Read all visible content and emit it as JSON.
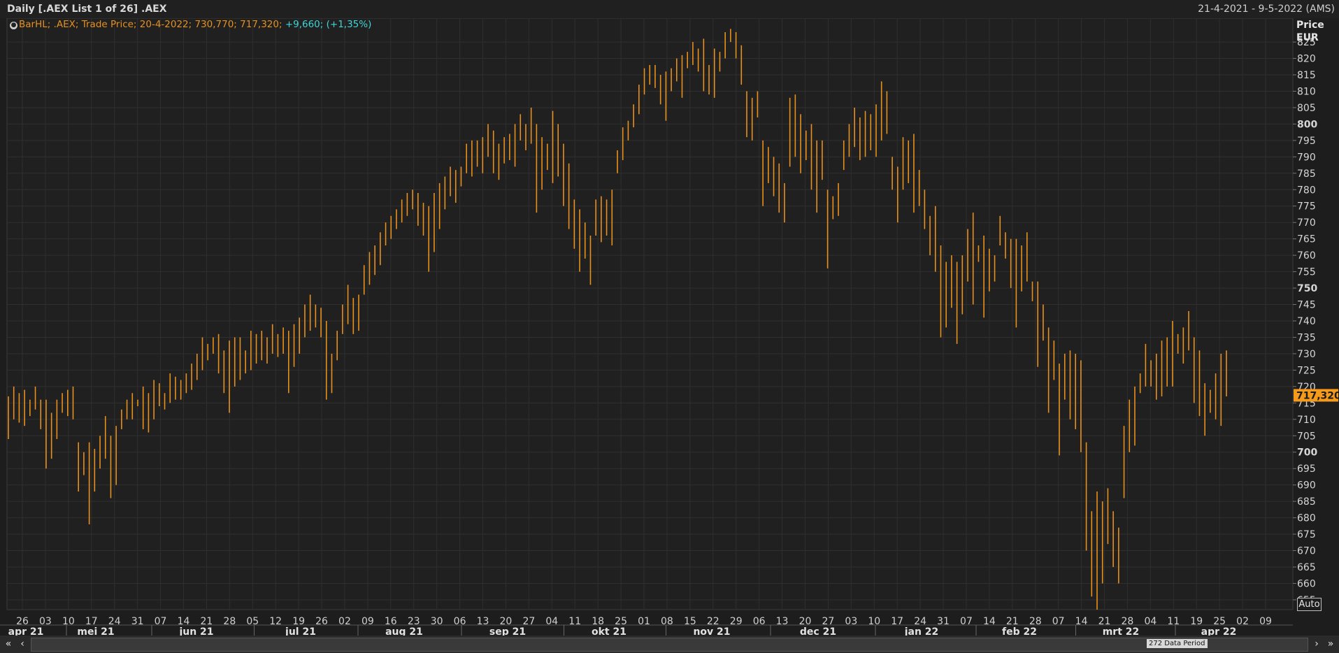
{
  "window": {
    "title": "Daily [.AEX List 1 of 26] .AEX",
    "date_range": "21-4-2021 - 9-5-2022 (AMS)"
  },
  "legend": {
    "text": "BarHL; .AEX; Trade Price; 20-4-2022; 730,770; 717,320;",
    "change": "+9,660; (+1,35%)"
  },
  "axis": {
    "title_line1": "Price",
    "title_line2": "EUR",
    "last_price_label": "717,320",
    "auto_label": "Auto"
  },
  "scrollbar": {
    "period_label": "272 Data Period",
    "left_fast": "«",
    "left": "‹",
    "right": "›",
    "right_fast": "»"
  },
  "colors": {
    "bar": "#e8901c",
    "price_tag": "#f59a1b",
    "change": "#3ed6d8",
    "background": "#1d1d1d",
    "grid": "#2f2f2f"
  },
  "chart_data": {
    "type": "bar",
    "style": "high-low bars",
    "ylim": [
      652,
      828
    ],
    "y_ticks": [
      655,
      660,
      665,
      670,
      675,
      680,
      685,
      690,
      695,
      700,
      705,
      710,
      715,
      720,
      725,
      730,
      735,
      740,
      745,
      750,
      755,
      760,
      765,
      770,
      775,
      780,
      785,
      790,
      795,
      800,
      805,
      810,
      815,
      820,
      825
    ],
    "y_bold_ticks": [
      700,
      750,
      800
    ],
    "last_value": 717.32,
    "x_tick_labels": [
      "26",
      "03",
      "10",
      "17",
      "24",
      "31",
      "07",
      "14",
      "21",
      "28",
      "05",
      "12",
      "19",
      "26",
      "02",
      "09",
      "16",
      "23",
      "30",
      "06",
      "13",
      "20",
      "27",
      "04",
      "11",
      "18",
      "25",
      "01",
      "08",
      "15",
      "22",
      "29",
      "06",
      "13",
      "20",
      "27",
      "03",
      "10",
      "17",
      "24",
      "31",
      "07",
      "14",
      "21",
      "28",
      "07",
      "14",
      "21",
      "28",
      "04",
      "11",
      "19",
      "25",
      "02",
      "09"
    ],
    "month_labels": [
      "apr 21",
      "mei 21",
      "jun 21",
      "jul 21",
      "aug 21",
      "sep 21",
      "okt 21",
      "nov 21",
      "dec 21",
      "jan 22",
      "feb 22",
      "mrt 22",
      "apr 22"
    ],
    "bars": [
      [
        704,
        717
      ],
      [
        710,
        720
      ],
      [
        709,
        718
      ],
      [
        708,
        719
      ],
      [
        711,
        716
      ],
      [
        713,
        720
      ],
      [
        707,
        716
      ],
      [
        695,
        716
      ],
      [
        698,
        712
      ],
      [
        704,
        716
      ],
      [
        712,
        718
      ],
      [
        711,
        719
      ],
      [
        710,
        720
      ],
      [
        688,
        703
      ],
      [
        693,
        700
      ],
      [
        678,
        703
      ],
      [
        688,
        701
      ],
      [
        695,
        705
      ],
      [
        698,
        711
      ],
      [
        686,
        705
      ],
      [
        690,
        708
      ],
      [
        707,
        713
      ],
      [
        710,
        716
      ],
      [
        710,
        718
      ],
      [
        714,
        716
      ],
      [
        707,
        720
      ],
      [
        706,
        718
      ],
      [
        710,
        722
      ],
      [
        714,
        721
      ],
      [
        713,
        718
      ],
      [
        715,
        724
      ],
      [
        716,
        723
      ],
      [
        716,
        722
      ],
      [
        718,
        724
      ],
      [
        719,
        727
      ],
      [
        722,
        730
      ],
      [
        725,
        735
      ],
      [
        728,
        733
      ],
      [
        730,
        735
      ],
      [
        724,
        736
      ],
      [
        718,
        731
      ],
      [
        712,
        734
      ],
      [
        720,
        735
      ],
      [
        722,
        735
      ],
      [
        724,
        731
      ],
      [
        725,
        737
      ],
      [
        727,
        736
      ],
      [
        728,
        737
      ],
      [
        727,
        735
      ],
      [
        730,
        739
      ],
      [
        729,
        736
      ],
      [
        730,
        738
      ],
      [
        718,
        737
      ],
      [
        726,
        739
      ],
      [
        730,
        741
      ],
      [
        735,
        745
      ],
      [
        737,
        748
      ],
      [
        738,
        745
      ],
      [
        735,
        744
      ],
      [
        716,
        740
      ],
      [
        718,
        730
      ],
      [
        728,
        737
      ],
      [
        736,
        745
      ],
      [
        739,
        751
      ],
      [
        736,
        747
      ],
      [
        737,
        748
      ],
      [
        748,
        757
      ],
      [
        751,
        761
      ],
      [
        754,
        763
      ],
      [
        757,
        767
      ],
      [
        763,
        770
      ],
      [
        765,
        772
      ],
      [
        768,
        774
      ],
      [
        770,
        777
      ],
      [
        772,
        779
      ],
      [
        774,
        780
      ],
      [
        769,
        779
      ],
      [
        766,
        776
      ],
      [
        755,
        775
      ],
      [
        761,
        779
      ],
      [
        768,
        782
      ],
      [
        774,
        784
      ],
      [
        778,
        787
      ],
      [
        776,
        786
      ],
      [
        781,
        787
      ],
      [
        785,
        794
      ],
      [
        784,
        795
      ],
      [
        787,
        795
      ],
      [
        785,
        796
      ],
      [
        790,
        800
      ],
      [
        785,
        798
      ],
      [
        783,
        794
      ],
      [
        788,
        796
      ],
      [
        789,
        797
      ],
      [
        787,
        800
      ],
      [
        795,
        803
      ],
      [
        792,
        800
      ],
      [
        794,
        805
      ],
      [
        773,
        800
      ],
      [
        780,
        796
      ],
      [
        786,
        794
      ],
      [
        782,
        804
      ],
      [
        784,
        800
      ],
      [
        775,
        794
      ],
      [
        768,
        788
      ],
      [
        762,
        777
      ],
      [
        755,
        774
      ],
      [
        759,
        770
      ],
      [
        751,
        766
      ],
      [
        766,
        777
      ],
      [
        764,
        778
      ],
      [
        766,
        777
      ],
      [
        763,
        780
      ],
      [
        785,
        792
      ],
      [
        789,
        799
      ],
      [
        795,
        801
      ],
      [
        799,
        806
      ],
      [
        803,
        812
      ],
      [
        809,
        817
      ],
      [
        812,
        818
      ],
      [
        811,
        818
      ],
      [
        806,
        815
      ],
      [
        801,
        816
      ],
      [
        810,
        817
      ],
      [
        813,
        820
      ],
      [
        808,
        821
      ],
      [
        817,
        822
      ],
      [
        818,
        825
      ],
      [
        816,
        823
      ],
      [
        810,
        826
      ],
      [
        809,
        818
      ],
      [
        808,
        823
      ],
      [
        816,
        822
      ],
      [
        820,
        828
      ],
      [
        825,
        829
      ],
      [
        820,
        828
      ],
      [
        812,
        824
      ],
      [
        796,
        810
      ],
      [
        795,
        808
      ],
      [
        802,
        810
      ],
      [
        775,
        795
      ],
      [
        782,
        793
      ],
      [
        778,
        790
      ],
      [
        773,
        788
      ],
      [
        770,
        782
      ],
      [
        787,
        808
      ],
      [
        790,
        809
      ],
      [
        785,
        803
      ],
      [
        789,
        798
      ],
      [
        780,
        800
      ],
      [
        773,
        795
      ],
      [
        783,
        795
      ],
      [
        756,
        780
      ],
      [
        771,
        778
      ],
      [
        772,
        782
      ],
      [
        786,
        795
      ],
      [
        790,
        800
      ],
      [
        793,
        805
      ],
      [
        789,
        802
      ],
      [
        790,
        804
      ],
      [
        792,
        803
      ],
      [
        790,
        806
      ],
      [
        795,
        813
      ],
      [
        797,
        810
      ],
      [
        780,
        790
      ],
      [
        770,
        787
      ],
      [
        780,
        796
      ],
      [
        782,
        795
      ],
      [
        773,
        797
      ],
      [
        775,
        786
      ],
      [
        768,
        780
      ],
      [
        760,
        772
      ],
      [
        755,
        775
      ],
      [
        735,
        763
      ],
      [
        738,
        758
      ],
      [
        744,
        760
      ],
      [
        733,
        758
      ],
      [
        742,
        760
      ],
      [
        752,
        768
      ],
      [
        745,
        773
      ],
      [
        758,
        763
      ],
      [
        741,
        766
      ],
      [
        749,
        762
      ],
      [
        752,
        760
      ],
      [
        763,
        772
      ],
      [
        759,
        767
      ],
      [
        750,
        765
      ],
      [
        738,
        765
      ],
      [
        749,
        763
      ],
      [
        752,
        767
      ],
      [
        746,
        752
      ],
      [
        726,
        752
      ],
      [
        734,
        745
      ],
      [
        712,
        738
      ],
      [
        722,
        734
      ],
      [
        699,
        727
      ],
      [
        716,
        730
      ],
      [
        710,
        731
      ],
      [
        707,
        730
      ],
      [
        700,
        728
      ],
      [
        670,
        703
      ],
      [
        656,
        682
      ],
      [
        652,
        688
      ],
      [
        660,
        685
      ],
      [
        672,
        689
      ],
      [
        665,
        682
      ],
      [
        660,
        677
      ],
      [
        686,
        708
      ],
      [
        700,
        716
      ],
      [
        702,
        720
      ],
      [
        718,
        724
      ],
      [
        720,
        733
      ],
      [
        720,
        728
      ],
      [
        716,
        730
      ],
      [
        717,
        734
      ],
      [
        720,
        735
      ],
      [
        720,
        740
      ],
      [
        730,
        736
      ],
      [
        727,
        738
      ],
      [
        731,
        743
      ],
      [
        715,
        735
      ],
      [
        711,
        731
      ],
      [
        705,
        721
      ],
      [
        712,
        719
      ],
      [
        710,
        724
      ],
      [
        708,
        730
      ],
      [
        717,
        731
      ]
    ]
  }
}
